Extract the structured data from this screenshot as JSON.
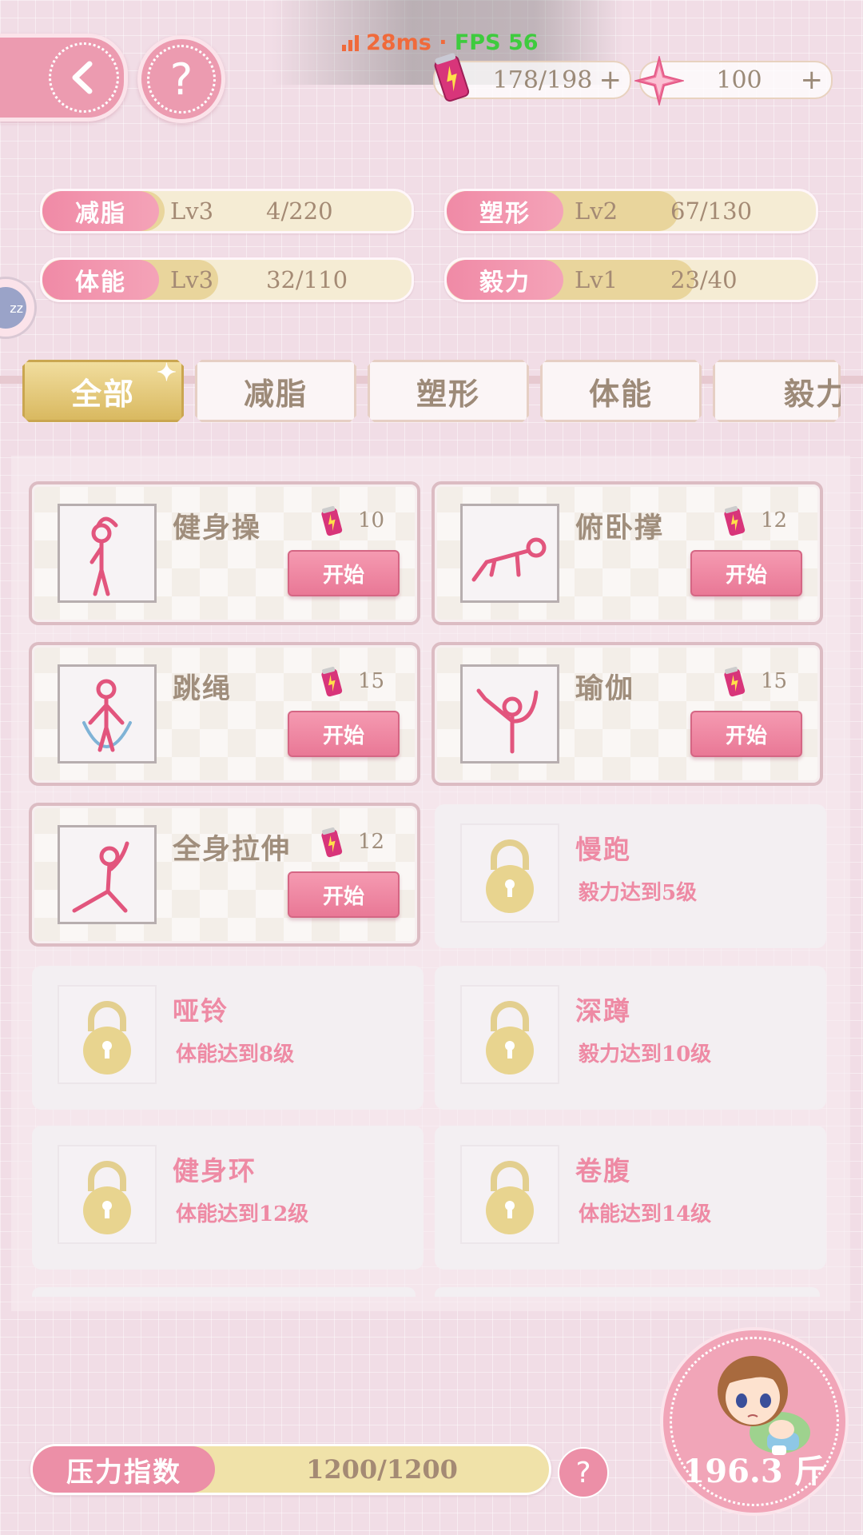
{
  "perf": {
    "ms": "28ms",
    "sep": "·",
    "fps": "FPS 56"
  },
  "resources": {
    "energy": {
      "value": "178/198",
      "icon": "energy-can-icon",
      "plus": "+"
    },
    "gem": {
      "value": "100",
      "icon": "pink-star-gem-icon",
      "plus": "+"
    }
  },
  "help_glyph": "?",
  "side_icon_text": "zz",
  "stats": [
    {
      "name": "减脂",
      "level": "Lv3",
      "progress": "4/220",
      "fraction": 0.02
    },
    {
      "name": "塑形",
      "level": "Lv2",
      "progress": "67/130",
      "fraction": 0.52
    },
    {
      "name": "体能",
      "level": "Lv3",
      "progress": "32/110",
      "fraction": 0.29
    },
    {
      "name": "毅力",
      "level": "Lv1",
      "progress": "23/40",
      "fraction": 0.58
    }
  ],
  "tabs": [
    {
      "label": "全部",
      "active": true
    },
    {
      "label": "减脂",
      "active": false
    },
    {
      "label": "塑形",
      "active": false
    },
    {
      "label": "体能",
      "active": false
    },
    {
      "label": "毅力",
      "active": false
    }
  ],
  "exercises": [
    {
      "title": "健身操",
      "cost": "10",
      "button": "开始",
      "locked": false,
      "icon": "aerobics-figure-icon"
    },
    {
      "title": "俯卧撑",
      "cost": "12",
      "button": "开始",
      "locked": false,
      "icon": "pushup-figure-icon"
    },
    {
      "title": "跳绳",
      "cost": "15",
      "button": "开始",
      "locked": false,
      "icon": "jump-rope-figure-icon"
    },
    {
      "title": "瑜伽",
      "cost": "15",
      "button": "开始",
      "locked": false,
      "icon": "yoga-figure-icon"
    },
    {
      "title": "全身拉伸",
      "cost": "12",
      "button": "开始",
      "locked": false,
      "icon": "stretch-figure-icon"
    },
    {
      "title": "慢跑",
      "requirement": "毅力达到5级",
      "locked": true
    },
    {
      "title": "哑铃",
      "requirement": "体能达到8级",
      "locked": true
    },
    {
      "title": "深蹲",
      "requirement": "毅力达到10级",
      "locked": true
    },
    {
      "title": "健身环",
      "requirement": "体能达到12级",
      "locked": true
    },
    {
      "title": "卷腹",
      "requirement": "体能达到14级",
      "locked": true
    }
  ],
  "stress": {
    "label": "压力指数",
    "value": "1200/1200",
    "help": "?"
  },
  "weight": "196.3 斤",
  "colors": {
    "accent_pink": "#ec8fa7",
    "gold": "#e9d59c",
    "text_brown": "#a48a74"
  }
}
